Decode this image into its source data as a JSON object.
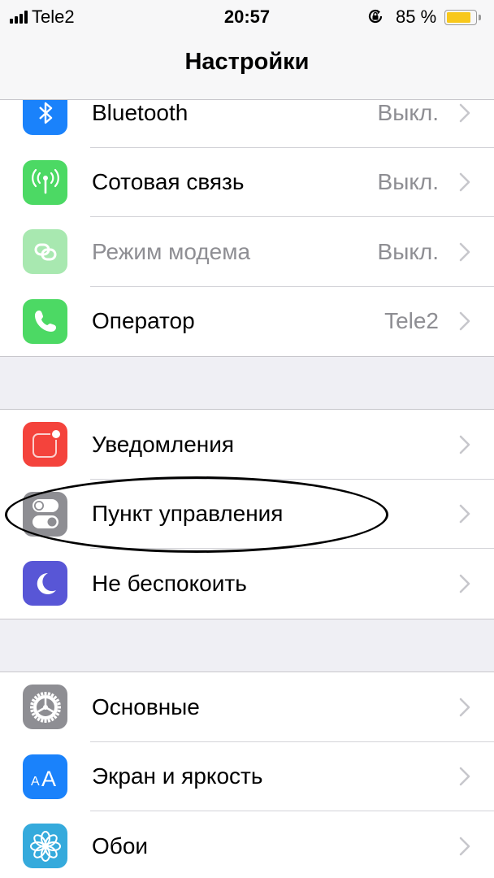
{
  "status_bar": {
    "carrier": "Tele2",
    "time": "20:57",
    "battery_percent_label": "85 %",
    "battery_level": 0.85,
    "battery_color": "#f8c81c",
    "orientation_lock_icon": "rotation-lock-icon"
  },
  "header": {
    "title": "Настройки"
  },
  "groups": [
    {
      "items": [
        {
          "label": "Bluetooth",
          "value": "Выкл.",
          "icon": "bluetooth-icon",
          "color": "#1a82fb"
        },
        {
          "label": "Сотовая связь",
          "value": "Выкл.",
          "icon": "cellular-antenna-icon",
          "color": "#4cd964"
        },
        {
          "label": "Режим модема",
          "value": "Выкл.",
          "icon": "personal-hotspot-icon",
          "color": "#a8e8b0",
          "disabled": true
        },
        {
          "label": "Оператор",
          "value": "Tele2",
          "icon": "phone-icon",
          "color": "#4cd964"
        }
      ]
    },
    {
      "items": [
        {
          "label": "Уведомления",
          "value": "",
          "icon": "notifications-icon",
          "color": "#f4433c"
        },
        {
          "label": "Пункт управления",
          "value": "",
          "icon": "control-center-icon",
          "color": "#8e8e93",
          "highlighted": true
        },
        {
          "label": "Не беспокоить",
          "value": "",
          "icon": "moon-icon",
          "color": "#5856d6"
        }
      ]
    },
    {
      "items": [
        {
          "label": "Основные",
          "value": "",
          "icon": "gear-icon",
          "color": "#8e8e93"
        },
        {
          "label": "Экран и яркость",
          "value": "",
          "icon": "display-brightness-icon",
          "color": "#1a82fb",
          "icon_text": "AA"
        },
        {
          "label": "Обои",
          "value": "",
          "icon": "wallpaper-flower-icon",
          "color": "#35aadc"
        }
      ]
    }
  ]
}
